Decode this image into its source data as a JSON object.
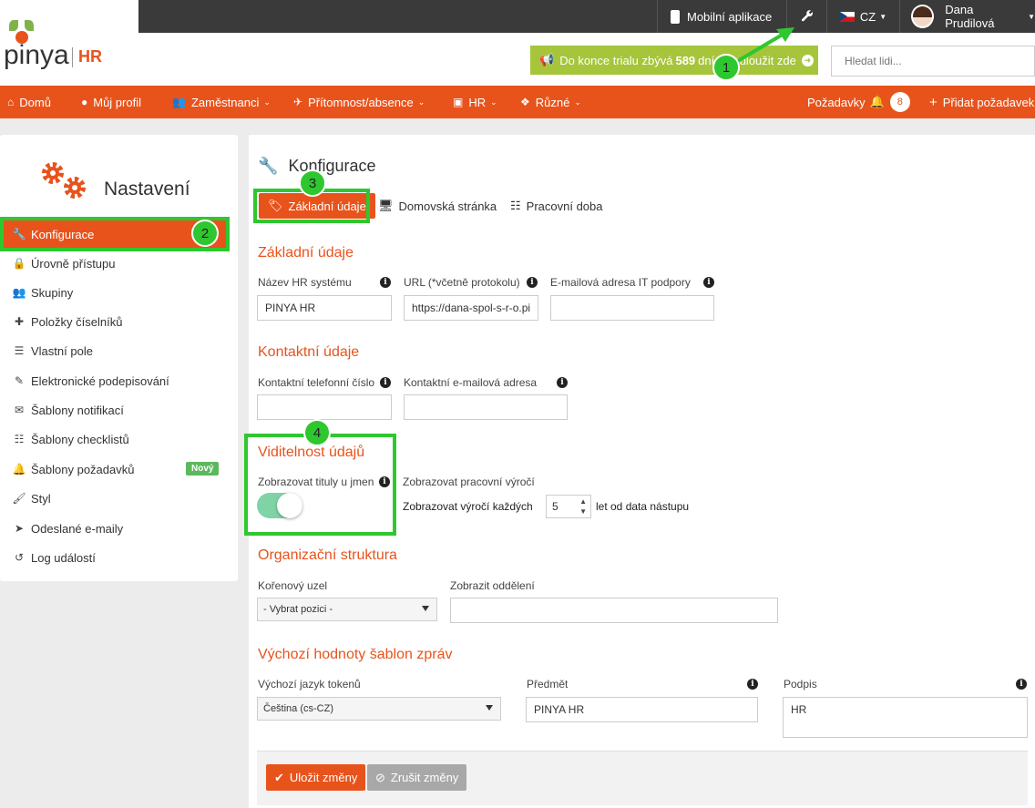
{
  "logo": {
    "brand": "pinya",
    "product": "HR"
  },
  "topbar": {
    "mobile_app": "Mobilní aplikace",
    "language": "CZ",
    "user_name": "Dana Prudilová"
  },
  "trial": {
    "text_before": "Do konce trialu zbývá",
    "days": "589",
    "text_after": "dní. Prodloužit zde"
  },
  "search": {
    "placeholder": "Hledat lidi..."
  },
  "nav": {
    "items": [
      {
        "label": "Domů"
      },
      {
        "label": "Můj profil"
      },
      {
        "label": "Zaměstnanci"
      },
      {
        "label": "Přítomnost/absence"
      },
      {
        "label": "HR"
      },
      {
        "label": "Různé"
      }
    ],
    "requests_label": "Požadavky",
    "requests_count": "8",
    "add_request": "Přidat požadavek"
  },
  "sidebar": {
    "title": "Nastavení",
    "items": [
      {
        "label": "Konfigurace"
      },
      {
        "label": "Úrovně přístupu"
      },
      {
        "label": "Skupiny"
      },
      {
        "label": "Položky číselníků"
      },
      {
        "label": "Vlastní pole"
      },
      {
        "label": "Elektronické podepisování"
      },
      {
        "label": "Šablony notifikací"
      },
      {
        "label": "Šablony checklistů"
      },
      {
        "label": "Šablony požadavků"
      },
      {
        "label": "Styl"
      },
      {
        "label": "Odeslané e-maily"
      },
      {
        "label": "Log událostí"
      }
    ],
    "new_badge": "Nový"
  },
  "main": {
    "title": "Konfigurace",
    "tabs": [
      {
        "label": "Základní údaje"
      },
      {
        "label": "Domovská stránka"
      },
      {
        "label": "Pracovní doba"
      }
    ],
    "basic": {
      "heading": "Základní údaje",
      "hr_name_label": "Název HR systému",
      "hr_name_value": "PINYA HR",
      "url_label": "URL (*včetně protokolu)",
      "url_value": "https://dana-spol-s-r-o.pi",
      "it_email_label": "E-mailová adresa IT podpory",
      "it_email_value": ""
    },
    "contact": {
      "heading": "Kontaktní údaje",
      "phone_label": "Kontaktní telefonní číslo",
      "email_label": "Kontaktní e-mailová adresa"
    },
    "visibility": {
      "heading": "Viditelnost údajů",
      "titles_label": "Zobrazovat tituly u jmen",
      "titles_on": true,
      "anniv_label": "Zobrazovat pracovní výročí",
      "anniv_every": "Zobrazovat výročí každých",
      "anniv_value": "5",
      "anniv_suffix": "let od data nástupu"
    },
    "org": {
      "heading": "Organizační struktura",
      "root_label": "Kořenový uzel",
      "root_value": "- Vybrat pozici -",
      "dept_label": "Zobrazit oddělení"
    },
    "templates": {
      "heading": "Výchozí hodnoty šablon zpráv",
      "lang_label": "Výchozí jazyk tokenů",
      "lang_value": "Čeština (cs-CZ)",
      "subject_label": "Předmět",
      "subject_value": "PINYA HR",
      "signature_label": "Podpis",
      "signature_value": "HR"
    },
    "save": "Uložit změny",
    "cancel": "Zrušit změny"
  },
  "annotations": [
    "1",
    "2",
    "3",
    "4"
  ],
  "colors": {
    "accent": "#e8531c",
    "trial": "#a6c53a",
    "highlight": "#2fc72f",
    "dark": "#3a3a3a"
  }
}
